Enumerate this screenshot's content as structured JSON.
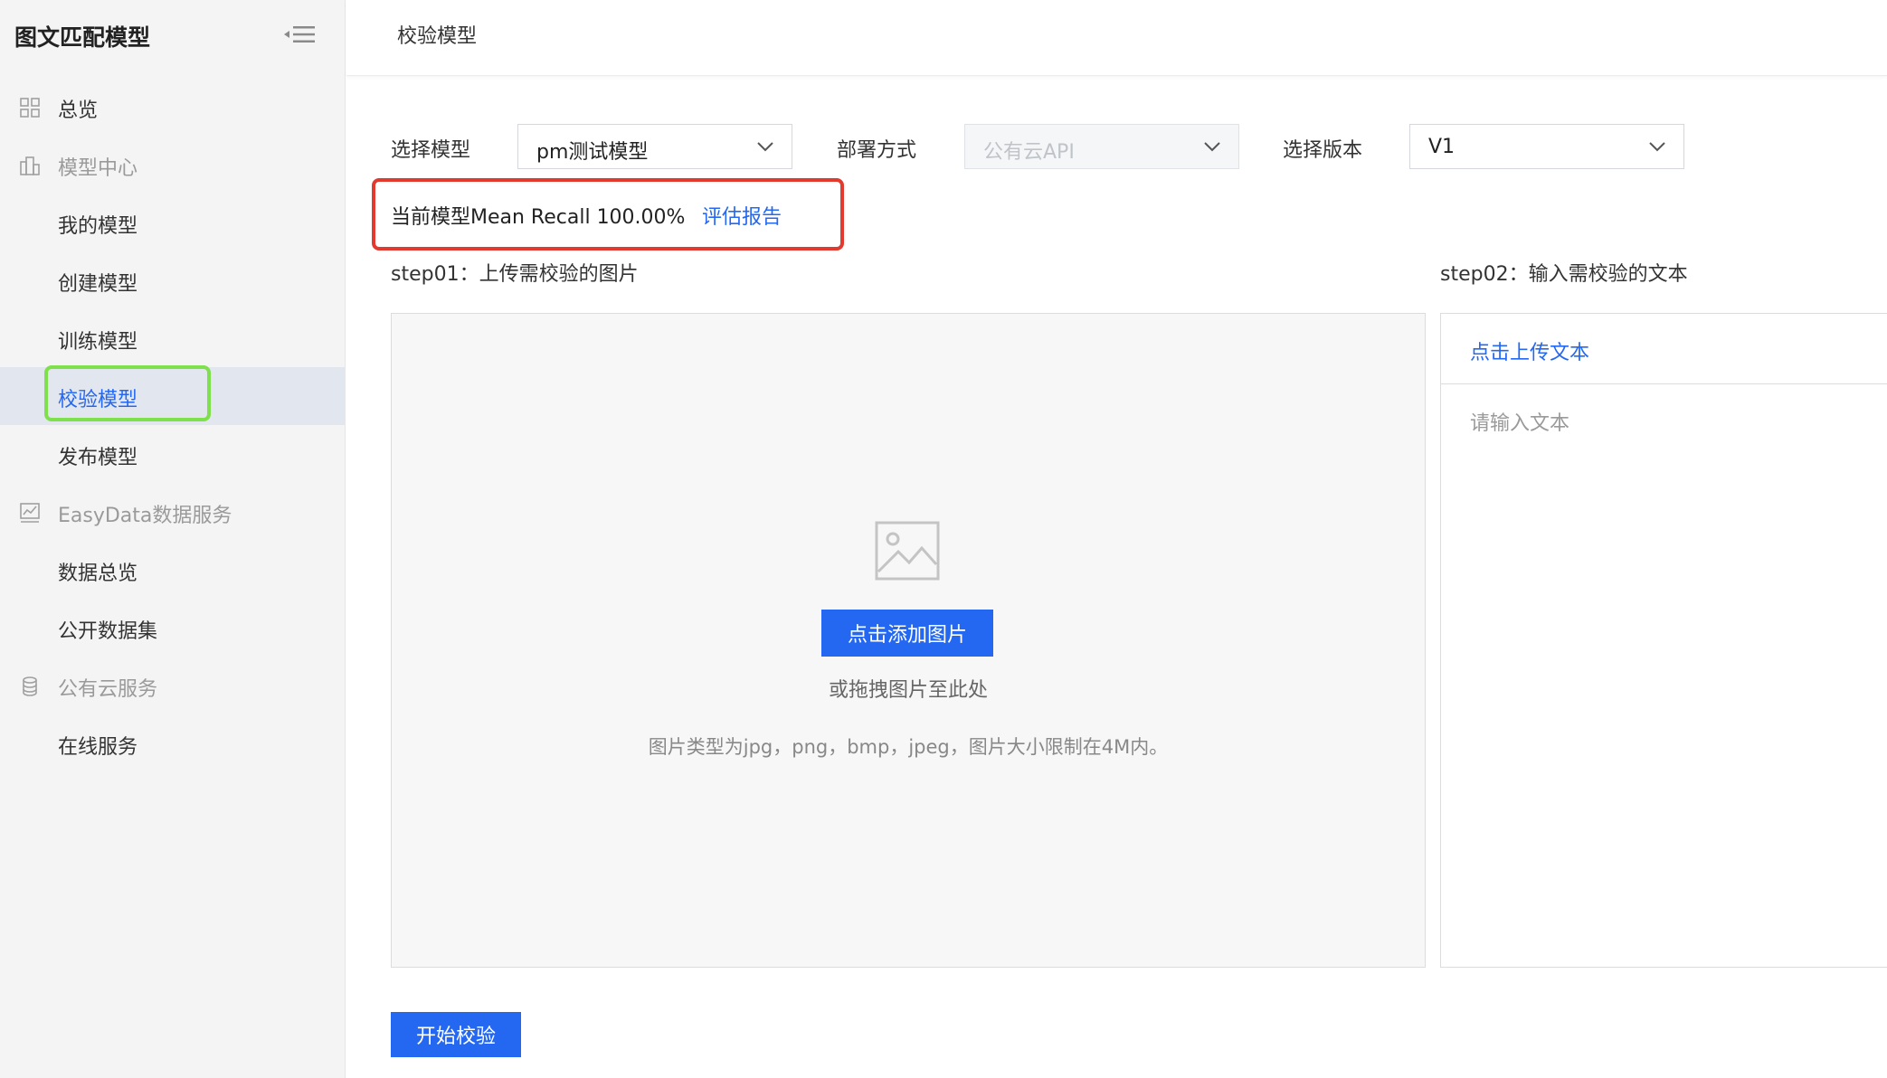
{
  "app": {
    "title": "图文匹配模型"
  },
  "sidebar": {
    "items": [
      {
        "label": "总览"
      },
      {
        "label": "模型中心"
      },
      {
        "label": "我的模型"
      },
      {
        "label": "创建模型"
      },
      {
        "label": "训练模型"
      },
      {
        "label": "校验模型"
      },
      {
        "label": "发布模型"
      },
      {
        "label": "EasyData数据服务"
      },
      {
        "label": "数据总览"
      },
      {
        "label": "公开数据集"
      },
      {
        "label": "公有云服务"
      },
      {
        "label": "在线服务"
      }
    ],
    "active_item": "校验模型"
  },
  "header": {
    "title": "校验模型"
  },
  "selectors": {
    "model": {
      "label": "选择模型",
      "value": "pm测试模型"
    },
    "deploy": {
      "label": "部署方式",
      "value": "公有云API"
    },
    "version": {
      "label": "选择版本",
      "value": "V1"
    }
  },
  "recall": {
    "text": "当前模型Mean Recall 100.00%",
    "report_link": "评估报告"
  },
  "step1": {
    "label": "step01：上传需校验的图片",
    "add_button": "点击添加图片",
    "drag_hint": "或拖拽图片至此处",
    "type_hint": "图片类型为jpg，png，bmp，jpeg，图片大小限制在4M内。"
  },
  "step2": {
    "label": "step02：输入需校验的文本",
    "upload_link": "点击上传文本",
    "input_placeholder": "请输入文本"
  },
  "actions": {
    "start_button": "开始校验"
  },
  "colors": {
    "primary": "#2468f2",
    "highlight_red": "#e23a2e",
    "highlight_green": "#7ee04a",
    "sidebar_bg": "#f4f4f5"
  }
}
